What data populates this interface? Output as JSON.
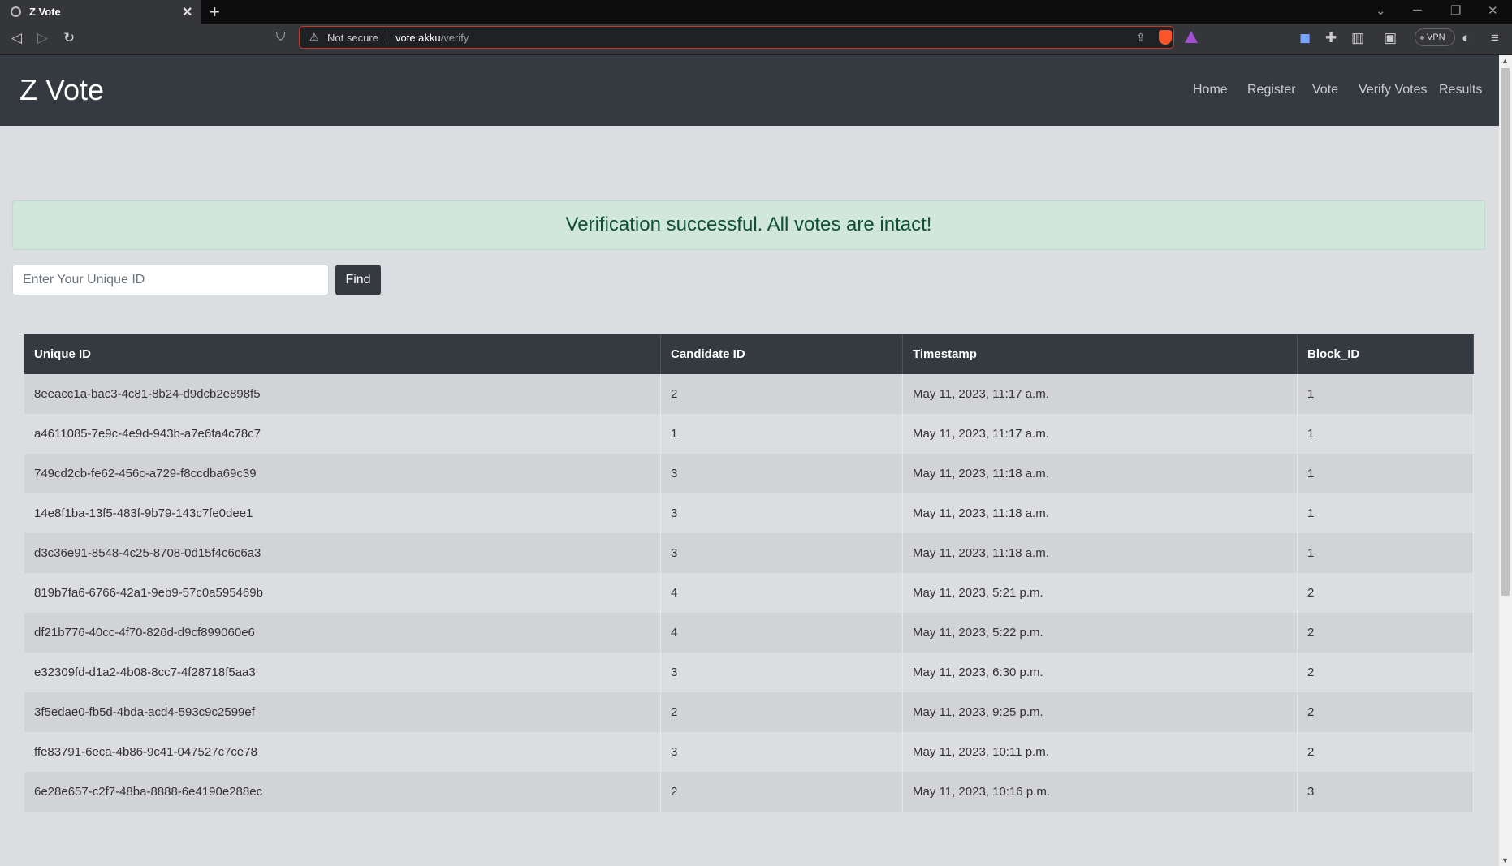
{
  "browser": {
    "tab_title": "Z Vote",
    "security_label": "Not secure",
    "url_host": "vote.akku",
    "url_path": "/verify",
    "vpn_label": "VPN"
  },
  "site": {
    "brand": "Z Vote",
    "nav": [
      "Home",
      "Register",
      "Vote",
      "Verify Votes",
      "Results"
    ]
  },
  "alert": {
    "message": "Verification successful. All votes are intact!"
  },
  "search": {
    "placeholder": "Enter Your Unique ID",
    "button": "Find"
  },
  "table": {
    "headers": [
      "Unique ID",
      "Candidate ID",
      "Timestamp",
      "Block_ID"
    ],
    "rows": [
      [
        "8eeacc1a-bac3-4c81-8b24-d9dcb2e898f5",
        "2",
        "May 11, 2023, 11:17 a.m.",
        "1"
      ],
      [
        "a4611085-7e9c-4e9d-943b-a7e6fa4c78c7",
        "1",
        "May 11, 2023, 11:17 a.m.",
        "1"
      ],
      [
        "749cd2cb-fe62-456c-a729-f8ccdba69c39",
        "3",
        "May 11, 2023, 11:18 a.m.",
        "1"
      ],
      [
        "14e8f1ba-13f5-483f-9b79-143c7fe0dee1",
        "3",
        "May 11, 2023, 11:18 a.m.",
        "1"
      ],
      [
        "d3c36e91-8548-4c25-8708-0d15f4c6c6a3",
        "3",
        "May 11, 2023, 11:18 a.m.",
        "1"
      ],
      [
        "819b7fa6-6766-42a1-9eb9-57c0a595469b",
        "4",
        "May 11, 2023, 5:21 p.m.",
        "2"
      ],
      [
        "df21b776-40cc-4f70-826d-d9cf899060e6",
        "4",
        "May 11, 2023, 5:22 p.m.",
        "2"
      ],
      [
        "e32309fd-d1a2-4b08-8cc7-4f28718f5aa3",
        "3",
        "May 11, 2023, 6:30 p.m.",
        "2"
      ],
      [
        "3f5edae0-fb5d-4bda-acd4-593c9c2599ef",
        "2",
        "May 11, 2023, 9:25 p.m.",
        "2"
      ],
      [
        "ffe83791-6eca-4b86-9c41-047527c7ce78",
        "3",
        "May 11, 2023, 10:11 p.m.",
        "2"
      ],
      [
        "6e28e657-c2f7-48ba-8888-6e4190e288ec",
        "2",
        "May 11, 2023, 10:16 p.m.",
        "3"
      ]
    ]
  },
  "colors": {
    "navbar": "#343a40",
    "alert_bg": "#d1e7dd",
    "alert_text": "#0f5132",
    "page_bg": "#dcdde1"
  }
}
